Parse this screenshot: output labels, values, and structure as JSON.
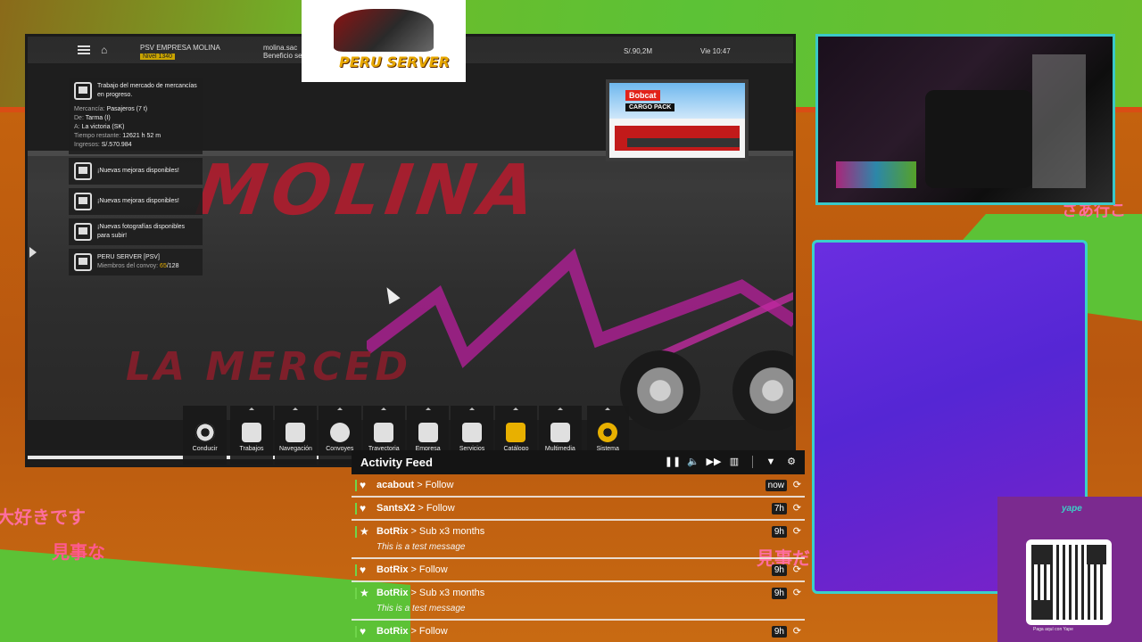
{
  "game": {
    "company": "PSV EMPRESA MOLINA",
    "level": "Nivel 1340",
    "partner_name": "molina.sac",
    "partner_sub": "Beneficio ser",
    "money": "S/.90,2M",
    "clock": "Vie 10:47",
    "livery_top": "MOLINA",
    "livery_bottom": "LA MERCED",
    "job": {
      "title": "Trabajo del mercado de mercancías en progreso.",
      "cargo_label": "Mercancía:",
      "cargo": "Pasajeros (7 t)",
      "from_label": "De:",
      "from": "Tarma (I)",
      "to_label": "A:",
      "to": "La victoria (SK)",
      "time_label": "Tiempo restante:",
      "time": "12621 h 52 m",
      "income_label": "Ingresos:",
      "income": "S/.570.984"
    },
    "notifications": [
      {
        "text": "¡Nuevas mejoras disponibles!"
      },
      {
        "text": "¡Nuevas mejoras disponibles!"
      },
      {
        "text": "¡Nuevas fotografías disponibles para subir!"
      }
    ],
    "convoy": {
      "name": "PERU SERVER [PSV]",
      "members_label": "Miembros del convoy:",
      "current": "65",
      "max": "/128"
    },
    "ad": {
      "brand": "Bobcat",
      "pack": "CARGO PACK"
    },
    "dock": [
      {
        "label": "Conducir",
        "icon": "steering-wheel-icon"
      },
      {
        "label": "Trabajos",
        "icon": "jobs-icon"
      },
      {
        "label": "Navegación",
        "icon": "map-icon"
      },
      {
        "label": "Convoyes",
        "icon": "globe-icon"
      },
      {
        "label": "Trayectoria",
        "icon": "profile-icon"
      },
      {
        "label": "Empresa",
        "icon": "bus-icon"
      },
      {
        "label": "Servicios",
        "icon": "services-icon"
      },
      {
        "label": "Catálogo",
        "icon": "catalog-icon"
      },
      {
        "label": "Multimedia",
        "icon": "media-icon"
      },
      {
        "label": "Sistema",
        "icon": "gear-icon"
      }
    ]
  },
  "logo": {
    "text": "PERU SERVER"
  },
  "overlay_text": {
    "jp1": "大好きです",
    "jp2": "見事な",
    "jp3": "見事だ",
    "jp4": "さあ行こ"
  },
  "yape": {
    "logo": "yape",
    "caption": "Paga aquí con Yape"
  },
  "feed": {
    "title": "Activity Feed",
    "tools": [
      "pause-icon",
      "volume-icon",
      "skip-icon",
      "trash-icon",
      "filter-icon",
      "settings-icon"
    ],
    "rows": [
      {
        "user": "acabout",
        "action": "Follow",
        "time": "now",
        "icon": "heart-icon",
        "message": ""
      },
      {
        "user": "SantsX2",
        "action": "Follow",
        "time": "7h",
        "icon": "heart-icon",
        "message": ""
      },
      {
        "user": "BotRix",
        "action": "Sub x3 months",
        "time": "9h",
        "icon": "star-icon",
        "message": "This is a test message"
      },
      {
        "user": "BotRix",
        "action": "Follow",
        "time": "9h",
        "icon": "heart-icon",
        "message": ""
      },
      {
        "user": "BotRix",
        "action": "Sub x3 months",
        "time": "9h",
        "icon": "star-icon",
        "message": "This is a test message"
      },
      {
        "user": "BotRix",
        "action": "Follow",
        "time": "9h",
        "icon": "heart-icon",
        "message": ""
      }
    ]
  },
  "colors": {
    "accent_green": "#6fd54a",
    "frame_teal": "#3ad1c8",
    "panel_purple": "#5526d4",
    "game_gold": "#e9b000"
  }
}
